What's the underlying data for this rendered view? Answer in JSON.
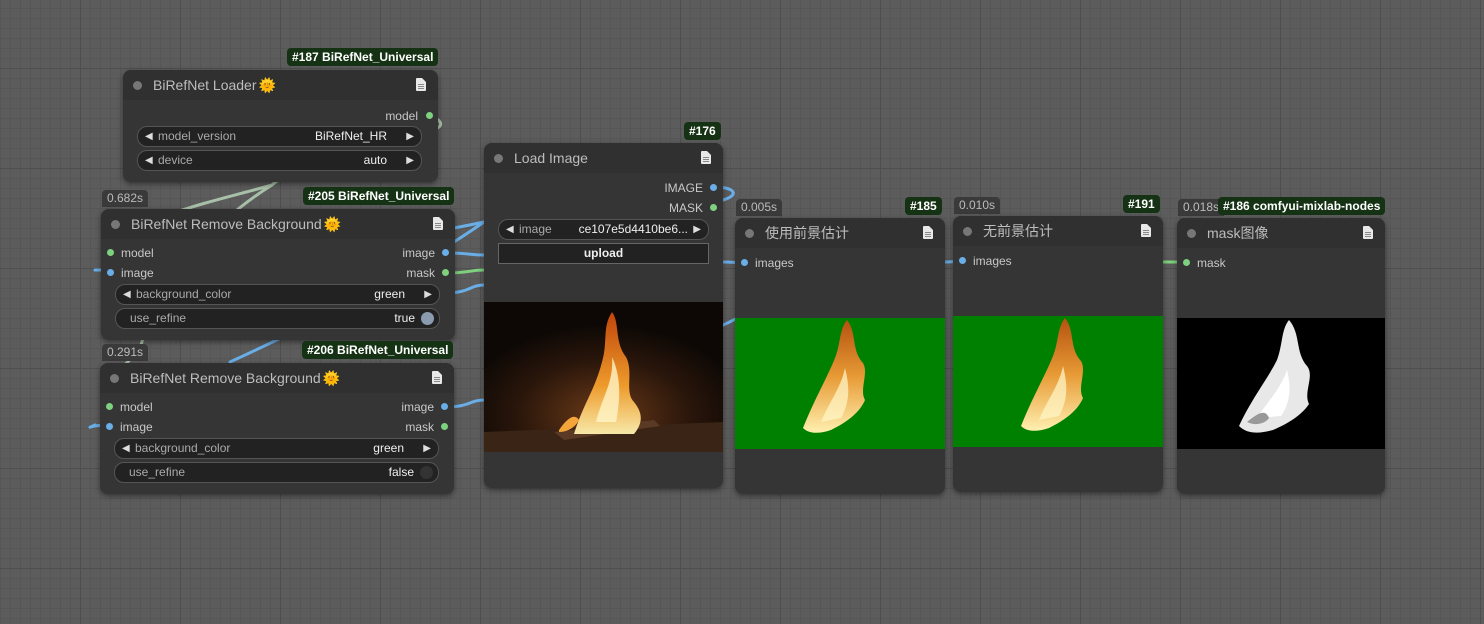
{
  "nodes": {
    "loader": {
      "badge": "#187 BiRefNet_Universal",
      "title": "BiRefNet Loader",
      "sun": "🌞",
      "output_model": "model",
      "model_version_label": "model_version",
      "model_version_value": "BiRefNet_HR",
      "device_label": "device",
      "device_value": "auto"
    },
    "remove1": {
      "time": "0.682s",
      "badge": "#205 BiRefNet_Universal",
      "title": "BiRefNet Remove Background",
      "sun": "🌞",
      "in_model": "model",
      "in_image": "image",
      "out_image": "image",
      "out_mask": "mask",
      "bg_label": "background_color",
      "bg_value": "green",
      "refine_label": "use_refine",
      "refine_value": "true"
    },
    "remove2": {
      "time": "0.291s",
      "badge": "#206 BiRefNet_Universal",
      "title": "BiRefNet Remove Background",
      "sun": "🌞",
      "in_model": "model",
      "in_image": "image",
      "out_image": "image",
      "out_mask": "mask",
      "bg_label": "background_color",
      "bg_value": "green",
      "refine_label": "use_refine",
      "refine_value": "false"
    },
    "load_image": {
      "badge": "#176",
      "title": "Load Image",
      "out_image": "IMAGE",
      "out_mask": "MASK",
      "image_label": "image",
      "image_value": "ce107e5d4410be6...",
      "upload_label": "upload"
    },
    "preview1": {
      "time": "0.005s",
      "badge": "#185",
      "title": "使用前景估计",
      "in_images": "images"
    },
    "preview2": {
      "time": "0.010s",
      "badge": "#191",
      "title": "无前景估计",
      "in_images": "images"
    },
    "preview3": {
      "time": "0.018s",
      "badge": "#186 comfyui-mixlab-nodes",
      "title": "mask图像",
      "in_mask": "mask"
    }
  },
  "colors": {
    "canvas": "#5c5c5c",
    "node_body": "#353535",
    "node_title": "#303030",
    "badge_bg": "#153215",
    "link_image": "#6aaee8",
    "link_mask": "#7ed17e",
    "link_model": "#a8c0a8",
    "preview_green": "#008000"
  },
  "icons": {
    "doc": "document-icon",
    "arrow_left": "◀",
    "arrow_right": "▶"
  }
}
